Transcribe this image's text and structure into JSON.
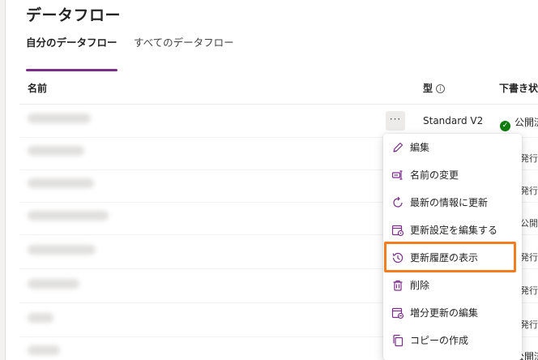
{
  "page": {
    "title": "データフロー"
  },
  "tabs": [
    {
      "label": "自分のデータフロー",
      "active": true
    },
    {
      "label": "すべてのデータフロー",
      "active": false
    }
  ],
  "columns": {
    "name": "名前",
    "type": "型",
    "type_info": "i",
    "status": "下書き状"
  },
  "rows": {
    "first_type": "Standard V2",
    "first_status": "公開済",
    "last_type": "Standard V2",
    "last_status": "公開済",
    "peek": [
      "発行",
      "発行",
      "公開",
      "公開",
      "発行",
      "発行",
      "発行"
    ]
  },
  "more_button": {
    "label": "···"
  },
  "context_menu": {
    "items": [
      {
        "label": "編集",
        "icon": "pencil-icon"
      },
      {
        "label": "名前の変更",
        "icon": "rename-icon"
      },
      {
        "label": "最新の情報に更新",
        "icon": "refresh-icon"
      },
      {
        "label": "更新設定を編集する",
        "icon": "calendar-settings-icon"
      },
      {
        "label": "更新履歴の表示",
        "icon": "history-icon",
        "highlighted": true
      },
      {
        "label": "削除",
        "icon": "trash-icon"
      },
      {
        "label": "増分更新の編集",
        "icon": "calendar-edit-icon"
      },
      {
        "label": "コピーの作成",
        "icon": "copy-icon"
      }
    ]
  },
  "colors": {
    "accent": "#7a2e8a",
    "highlight": "#f47c20",
    "success": "#107c10"
  }
}
